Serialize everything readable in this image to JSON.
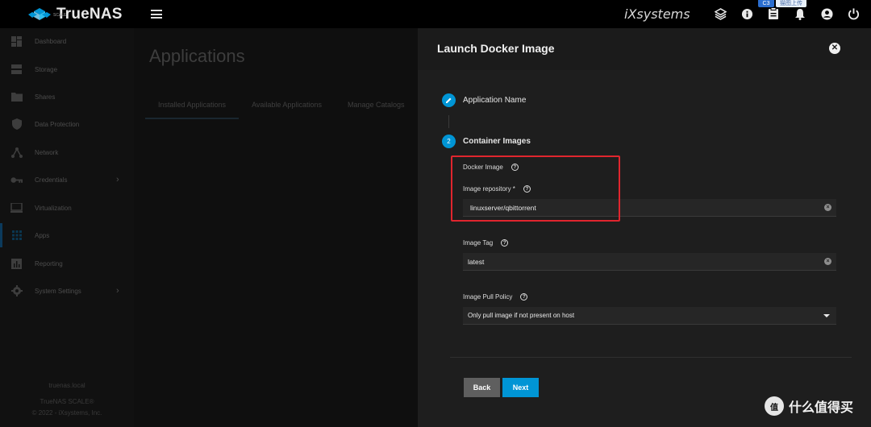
{
  "topbar": {
    "logo_text": "TrueNAS",
    "logo_sub": "SCALE",
    "vendor_logo": "iXsystems",
    "icons": [
      "truecommand-icon",
      "info-icon",
      "clipboard-icon",
      "bell-icon",
      "account-icon",
      "power-icon"
    ],
    "upload_badge": "C3",
    "upload_tip": "猫图上传"
  },
  "sidebar": {
    "items": [
      {
        "label": "Dashboard",
        "icon": "dashboard-icon"
      },
      {
        "label": "Storage",
        "icon": "storage-icon"
      },
      {
        "label": "Shares",
        "icon": "shares-icon"
      },
      {
        "label": "Data Protection",
        "icon": "shield-icon"
      },
      {
        "label": "Network",
        "icon": "network-icon"
      },
      {
        "label": "Credentials",
        "icon": "key-icon"
      },
      {
        "label": "Virtualization",
        "icon": "monitor-icon"
      },
      {
        "label": "Apps",
        "icon": "apps-grid-icon"
      },
      {
        "label": "Reporting",
        "icon": "chart-icon"
      },
      {
        "label": "System Settings",
        "icon": "gear-icon"
      }
    ],
    "hostname": "truenas.local",
    "product": "TrueNAS SCALE®",
    "copyright": "© 2022 - iXsystems, Inc."
  },
  "main": {
    "title": "Applications",
    "tabs": [
      "Installed Applications",
      "Available Applications",
      "Manage Catalogs"
    ]
  },
  "panel": {
    "title": "Launch Docker Image",
    "steps": [
      {
        "label": "Application Name",
        "marker": "edit"
      },
      {
        "label": "Container Images",
        "marker": "2"
      }
    ],
    "section_title": "Docker Image",
    "fields": {
      "repo_label": "Image repository *",
      "repo_value": "linuxserver/qbittorrent",
      "tag_label": "Image Tag",
      "tag_value": "latest",
      "policy_label": "Image Pull Policy",
      "policy_value": "Only pull image if not present on host"
    },
    "buttons": {
      "back": "Back",
      "next": "Next"
    }
  },
  "watermark": {
    "text": "什么值得买",
    "mark": "值"
  },
  "colors": {
    "accent": "#0095d5",
    "highlight": "#e0252e"
  }
}
